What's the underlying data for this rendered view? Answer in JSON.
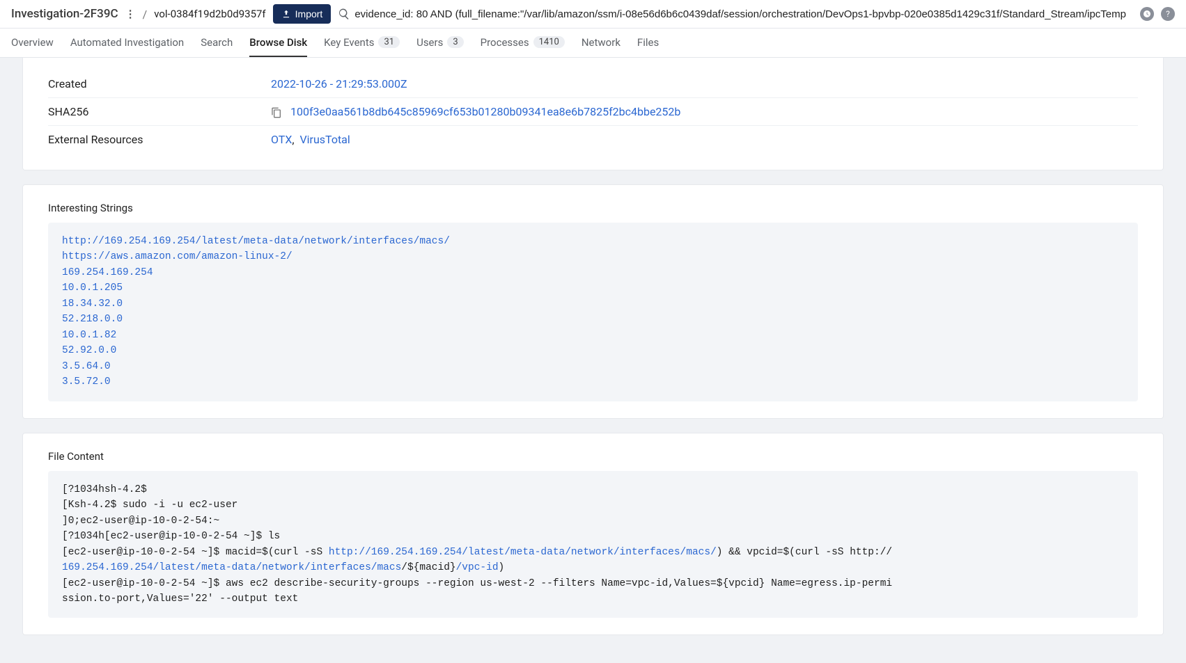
{
  "header": {
    "investigation_title": "Investigation-2F39C",
    "breadcrumb_sep": "/",
    "volume_id": "vol-0384f19d2b0d9357f",
    "import_label": "Import",
    "search_value": "evidence_id: 80 AND (full_filename:\"/var/lib/amazon/ssm/i-08e56d6b6c0439daf/session/orchestration/DevOps1-bpvbp-020e0385d1429c31f/Standard_Stream/ipcTemp"
  },
  "tabs": [
    {
      "label": "Overview",
      "badge": null,
      "active": false
    },
    {
      "label": "Automated Investigation",
      "badge": null,
      "active": false
    },
    {
      "label": "Search",
      "badge": null,
      "active": false
    },
    {
      "label": "Browse Disk",
      "badge": null,
      "active": true
    },
    {
      "label": "Key Events",
      "badge": "31",
      "active": false
    },
    {
      "label": "Users",
      "badge": "3",
      "active": false
    },
    {
      "label": "Processes",
      "badge": "1410",
      "active": false
    },
    {
      "label": "Network",
      "badge": null,
      "active": false
    },
    {
      "label": "Files",
      "badge": null,
      "active": false
    }
  ],
  "details": {
    "created_label": "Created",
    "created_value": "2022-10-26 - 21:29:53.000Z",
    "sha_label": "SHA256",
    "sha_value": "100f3e0aa561b8db645c85969cf653b01280b09341ea8e6b7825f2bc4bbe252b",
    "ext_label": "External Resources",
    "ext_otx": "OTX",
    "ext_sep": ",",
    "ext_vt": "VirusTotal"
  },
  "strings": {
    "title": "Interesting Strings",
    "items": [
      "http://169.254.169.254/latest/meta-data/network/interfaces/macs/",
      "https://aws.amazon.com/amazon-linux-2/",
      "169.254.169.254",
      "10.0.1.205",
      "18.34.32.0",
      "52.218.0.0",
      "10.0.1.82",
      "52.92.0.0",
      "3.5.64.0",
      "3.5.72.0"
    ]
  },
  "filecontent": {
    "title": "File Content",
    "line1": "[?1034hsh-4.2$",
    "line2": "[Ksh-4.2$ sudo -i -u ec2-user",
    "line3": "]0;ec2-user@ip-10-0-2-54:~",
    "line4": "[?1034h[ec2-user@ip-10-0-2-54 ~]$ ls",
    "line5a": "[ec2-user@ip-10-0-2-54 ~]$ macid=$(curl -sS ",
    "line5b": "http://169.254.169.254/latest/meta-data/network/interfaces/macs/",
    "line5c": ") && vpcid=$(curl -sS http://",
    "line6a": "169.254.169.254/latest/meta-data/network/interfaces/macs",
    "line6b": "/${macid}",
    "line6c": "/vpc-id",
    "line6d": ")",
    "line7": "[ec2-user@ip-10-0-2-54 ~]$ aws ec2 describe-security-groups --region us-west-2 --filters Name=vpc-id,Values=${vpcid} Name=egress.ip-permi",
    "line8": "ssion.to-port,Values='22'  --output text"
  }
}
